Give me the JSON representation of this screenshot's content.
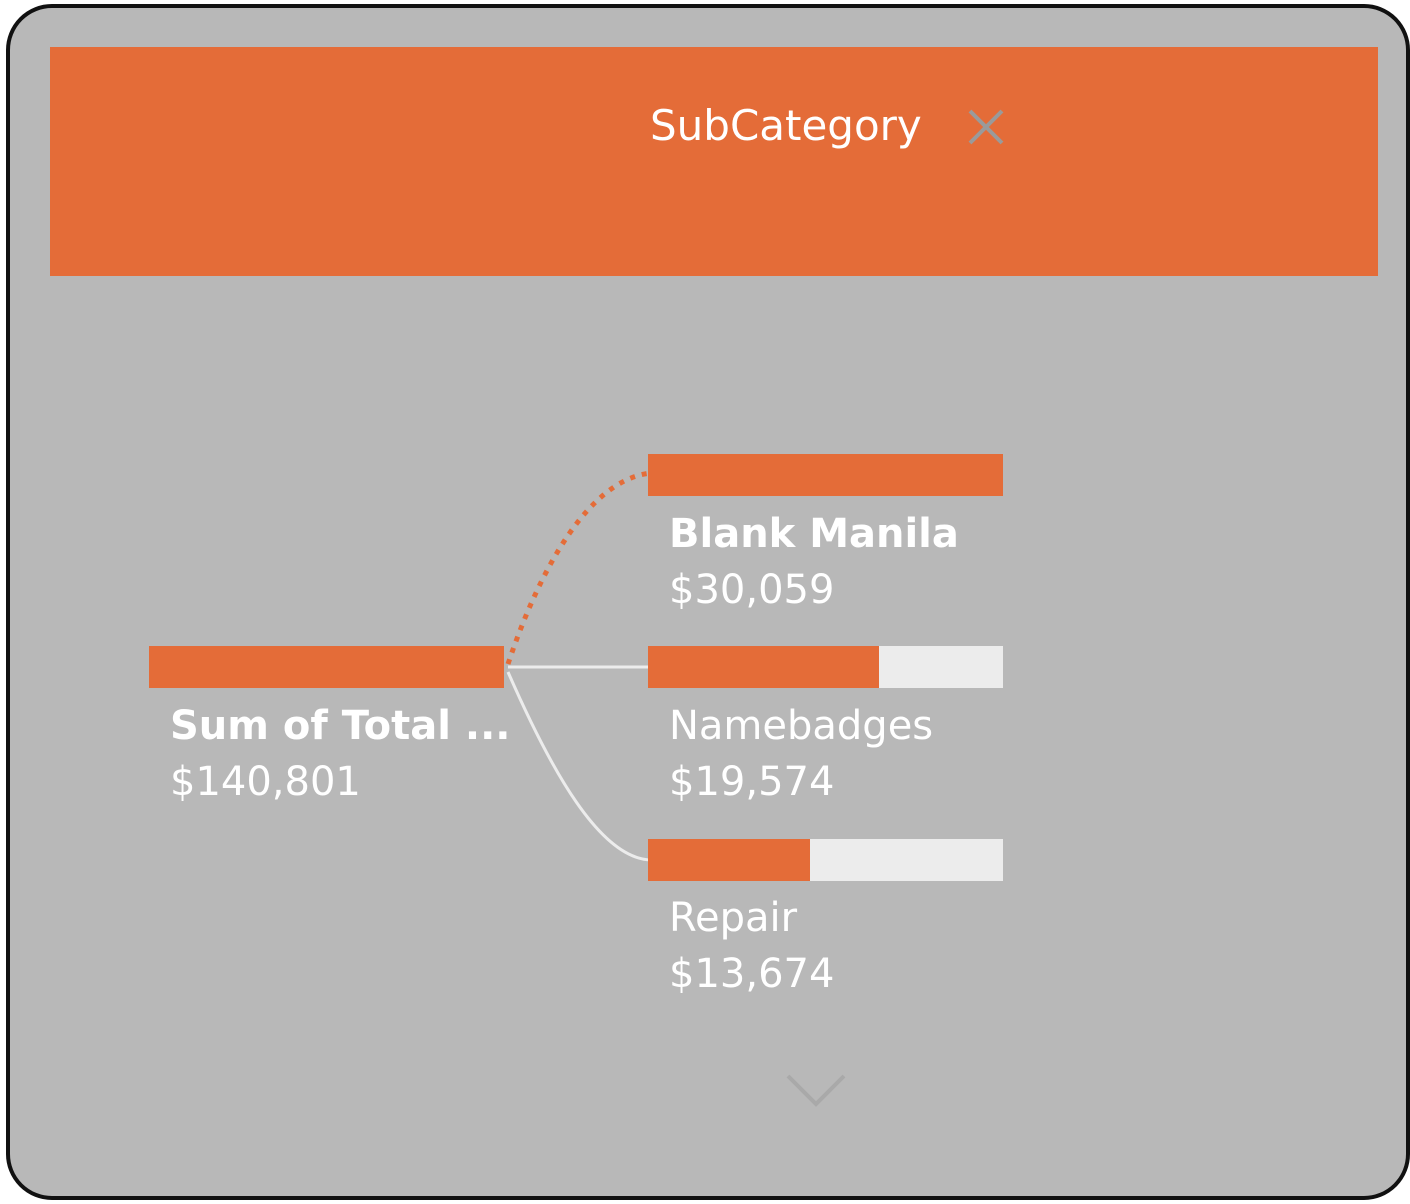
{
  "header": {
    "title": "SubCategory",
    "close_icon": "close-icon"
  },
  "colors": {
    "accent": "#e46c38",
    "background": "#b8b8b8",
    "bar_track": "#ececec",
    "text": "#ffffff"
  },
  "root": {
    "label": "Sum of Total ...",
    "value": "$140,801",
    "fill": 1.0
  },
  "children": [
    {
      "label": "Blank Manila",
      "value": "$30,059",
      "fill": 1.0,
      "selected": true
    },
    {
      "label": "Namebadges",
      "value": "$19,574",
      "fill": 0.651
    },
    {
      "label": "Repair",
      "value": "$13,674",
      "fill": 0.455
    }
  ],
  "more_icon": "chevron-down-icon"
}
